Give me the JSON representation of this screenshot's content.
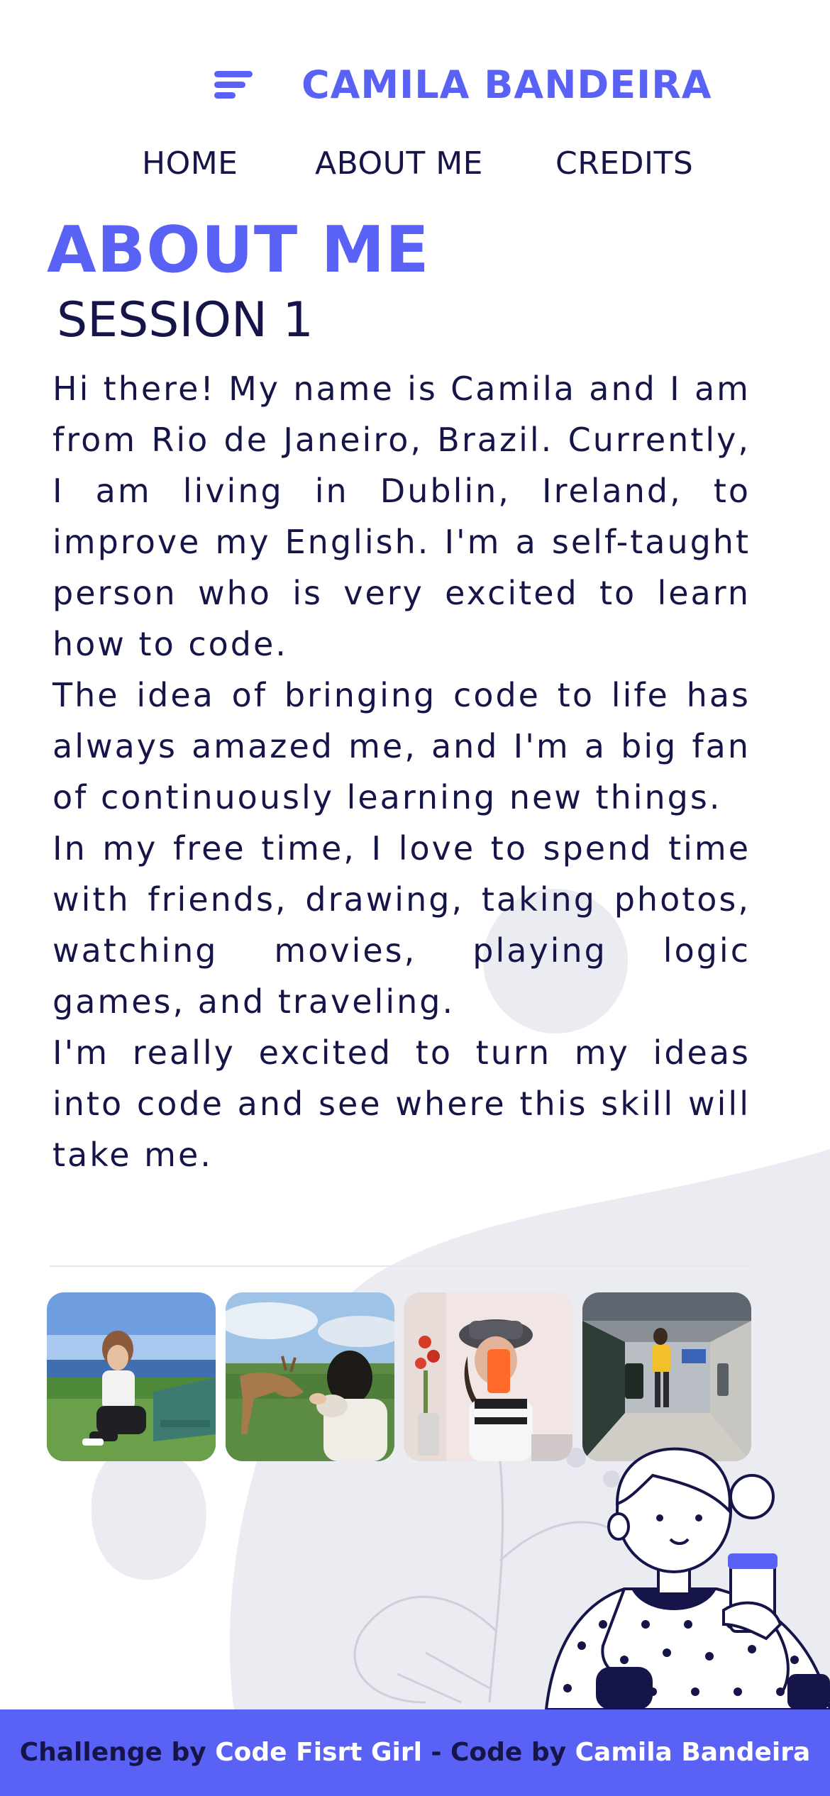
{
  "header": {
    "menu_icon": "hamburger-menu-icon",
    "brand": "CAMILA BANDEIRA"
  },
  "nav": {
    "items": [
      {
        "label": "HOME"
      },
      {
        "label": "ABOUT ME"
      },
      {
        "label": "CREDITS"
      }
    ]
  },
  "main": {
    "title": "ABOUT ME",
    "subtitle": "SESSION 1",
    "paragraphs": [
      "Hi there! My name is Camila and I am from Rio de Janeiro, Brazil. Currently, I am living in Dublin, Ireland, to improve my English. I'm a self-taught person who is very excited to learn how to code.",
      "The idea of bringing code to life has always amazed me, and I'm a big fan of continuously learning new things.",
      "In my free time, I love to spend time with friends, drawing, taking photos, watching movies, playing logic games, and traveling.",
      "I'm really excited to turn my ideas into code and see where this skill will take me."
    ]
  },
  "gallery": {
    "photos": [
      {
        "name": "seaside-bench-photo"
      },
      {
        "name": "feeding-deer-photo"
      },
      {
        "name": "mirror-selfie-photo"
      },
      {
        "name": "airport-photo"
      }
    ]
  },
  "footer": {
    "prefix": "Challenge by ",
    "org": "Code Fisrt Girl",
    "middle": " - Code by ",
    "author": "Camila Bandeira"
  },
  "colors": {
    "accent": "#5a62f5",
    "text": "#15154a",
    "blob": "#ebebf2",
    "footer_bg": "#5a62f5"
  }
}
